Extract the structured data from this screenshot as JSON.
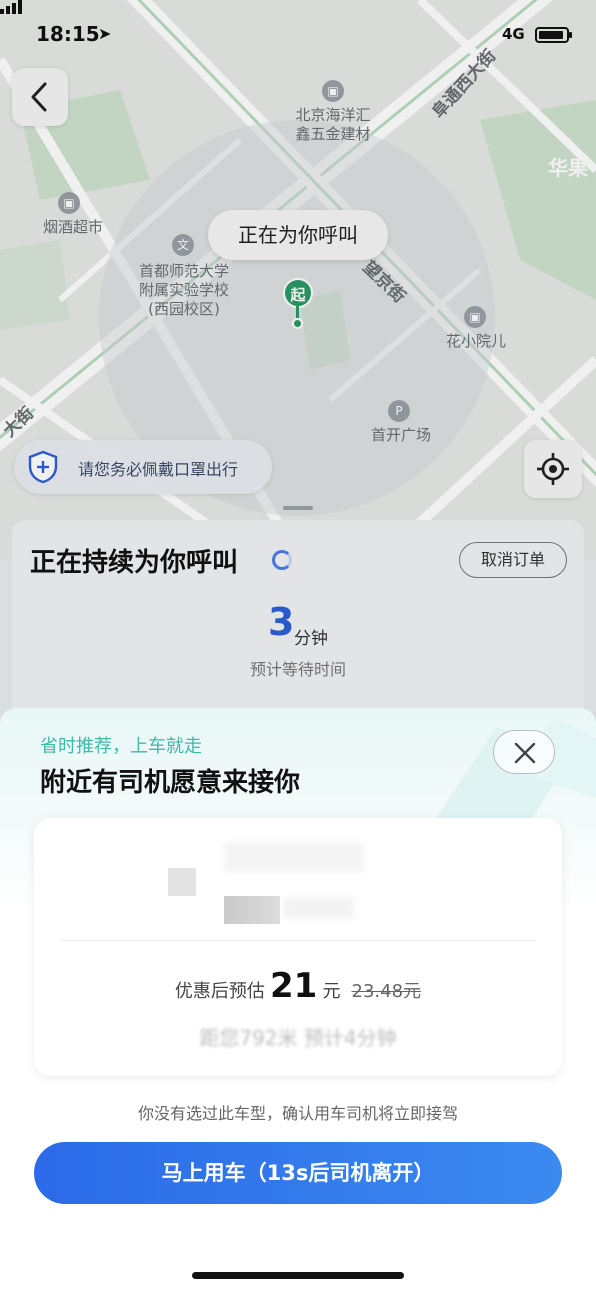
{
  "status_bar": {
    "time": "18:15",
    "network": "4G"
  },
  "map": {
    "pois": [
      {
        "name": "北京海洋汇\n鑫五金建材"
      },
      {
        "name": "烟酒超市"
      },
      {
        "name": "首都师范大学\n附属实验学校\n(西园校区)"
      },
      {
        "name": "花小院儿"
      },
      {
        "name": "首开广场"
      }
    ],
    "roads": [
      "阜通西大街",
      "望京街",
      "大街",
      "华果"
    ],
    "calling_bubble": "正在为你呼叫",
    "pin_label": "起",
    "mask_tip": "请您务必佩戴口罩出行"
  },
  "call_card": {
    "title": "正在持续为你呼叫",
    "cancel_label": "取消订单",
    "wait_minutes": "3",
    "wait_unit": "分钟",
    "wait_desc": "预计等待时间"
  },
  "sheet": {
    "subtitle": "省时推荐，上车就走",
    "title": "附近有司机愿意来接你",
    "offer": {
      "price_prefix": "优惠后预估",
      "price": "21",
      "price_unit": "元",
      "original_price": "23.48元",
      "distance_text": "距您792米 预计4分钟"
    },
    "confirm_note": "你没有选过此车型，确认用车司机将立即接驾",
    "go_button": "马上用车（13s后司机离开）"
  },
  "colors": {
    "accent_blue": "#2b6ae8",
    "teal": "#3fb9a8",
    "pin_green": "#2b9a64"
  }
}
